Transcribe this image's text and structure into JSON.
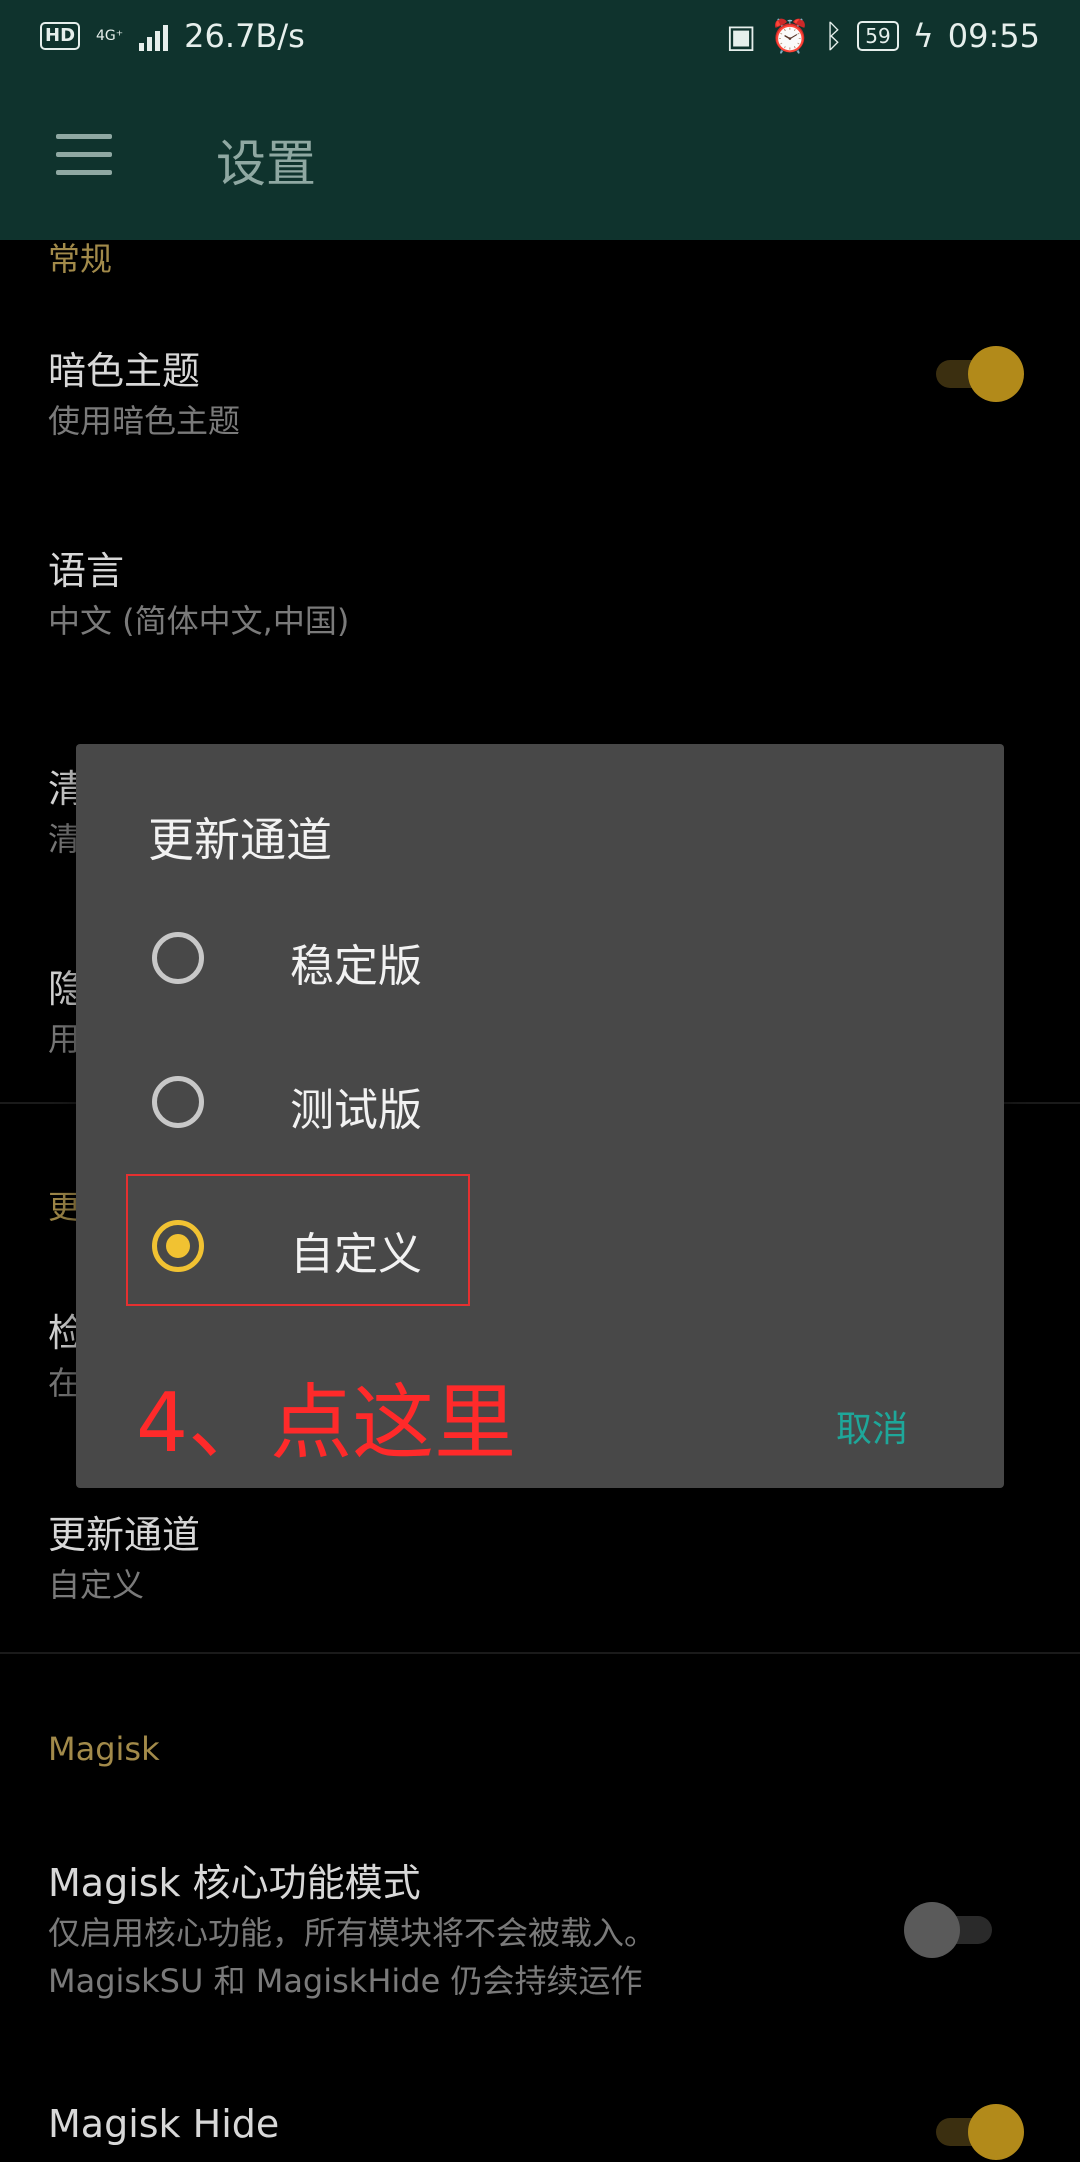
{
  "status_bar": {
    "hd": "HD",
    "network": "4G⁺",
    "speed": "26.7B/s",
    "battery": "59",
    "time": "09:55",
    "icons": [
      "nfc-icon",
      "alarm-icon",
      "bluetooth-icon",
      "charging-icon"
    ]
  },
  "app_bar": {
    "title": "设置"
  },
  "settings": {
    "general_header": "常规",
    "dark_theme": {
      "title": "暗色主题",
      "subtitle": "使用暗色主题",
      "enabled": true
    },
    "language": {
      "title": "语言",
      "subtitle": "中文 (简体中文,中国)"
    },
    "clear_partial": {
      "title": "清",
      "subtitle": "清"
    },
    "hide_partial": {
      "title": "隐",
      "subtitle": "用"
    },
    "update_header_partial": "更",
    "check_partial": {
      "title": "检",
      "subtitle": "在"
    },
    "update_channel": {
      "title": "更新通道",
      "subtitle": "自定义"
    },
    "magisk_header": "Magisk",
    "core_mode": {
      "title": "Magisk 核心功能模式",
      "subtitle_line1": "仅启用核心功能，所有模块将不会被载入。",
      "subtitle_line2": "MagiskSU 和 MagiskHide 仍会持续运作",
      "enabled": false
    },
    "magisk_hide": {
      "title": "Magisk Hide",
      "enabled": true
    }
  },
  "dialog": {
    "title": "更新通道",
    "options": [
      {
        "label": "稳定版",
        "checked": false
      },
      {
        "label": "测试版",
        "checked": false
      },
      {
        "label": "自定义",
        "checked": true
      }
    ],
    "annotation": "4、点这里",
    "cancel_label": "取消"
  },
  "colors": {
    "appbar": "#0f332d",
    "accent": "#f1c232",
    "section_header": "#a28a4a",
    "dialog_bg": "#484848",
    "cancel": "#1ea79a",
    "annotation": "#ff2a2a"
  }
}
